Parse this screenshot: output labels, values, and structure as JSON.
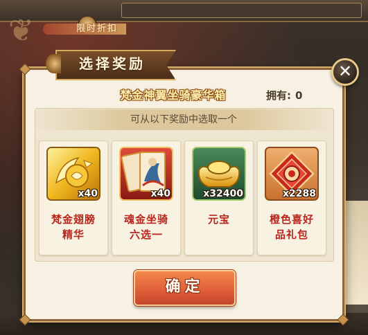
{
  "background": {
    "strip_text": "限时折扣"
  },
  "dialog": {
    "title": "选择奖励",
    "close_symbol": "✕",
    "chest_name": "梵金神翼坐骑豪华箱",
    "owned_label": "拥有:",
    "owned_count": "0",
    "instruction": "可从以下奖励中选取一个",
    "items": [
      {
        "icon": "golden-wing-essence-icon",
        "count": "x40",
        "name_line1": "梵金翅膀",
        "name_line2": "精华"
      },
      {
        "icon": "soul-gold-mount-card-icon",
        "count": "x40",
        "name_line1": "魂金坐骑",
        "name_line2": "六选一"
      },
      {
        "icon": "gold-ingot-icon",
        "count": "x32400",
        "name_line1": "元宝",
        "name_line2": ""
      },
      {
        "icon": "orange-gift-pack-icon",
        "count": "x2288",
        "name_line1": "橙色喜好",
        "name_line2": "品礼包"
      }
    ],
    "confirm_label": "确定"
  },
  "colors": {
    "item_name": "#b8261e",
    "confirm_button": "#e2603a",
    "dialog_border": "#8e6538",
    "title_banner": "#5a3820"
  }
}
